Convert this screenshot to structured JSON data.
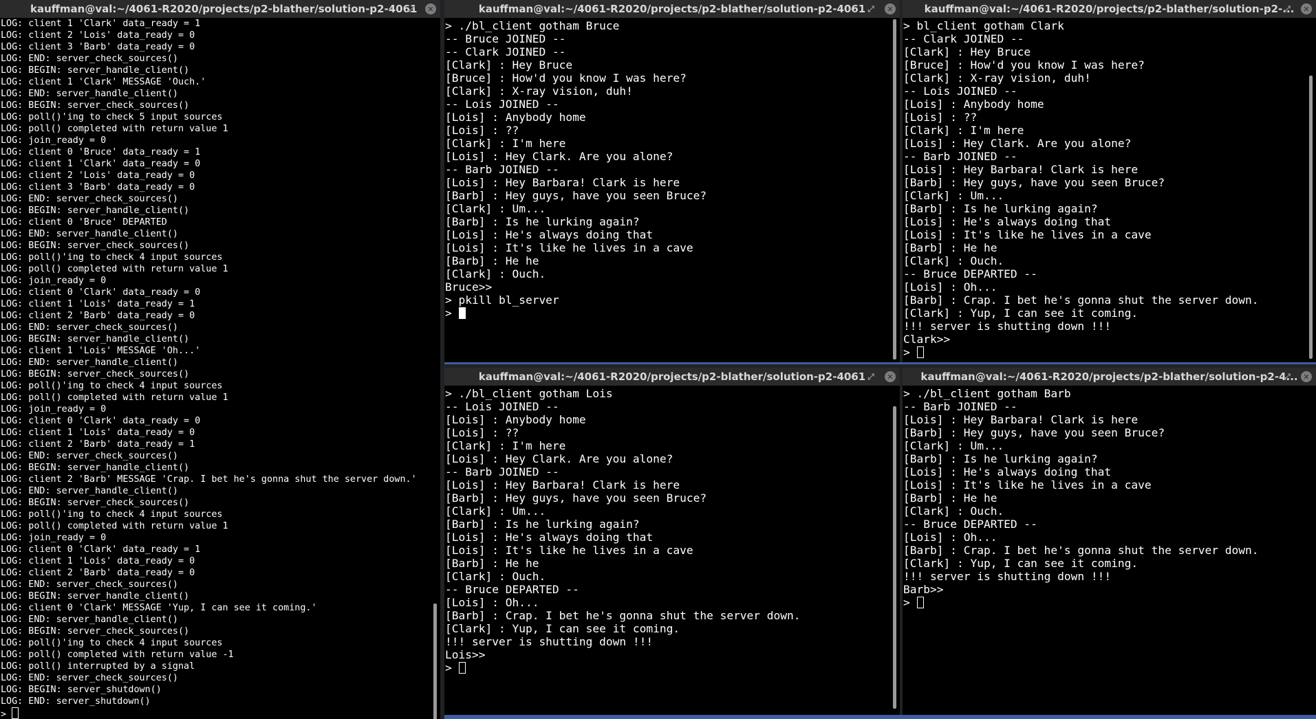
{
  "windows": {
    "server": {
      "title": "kauffman@val:~/4061-R2020/projects/p2-blather/solution-p2-4061",
      "lines": [
        "LOG: client 1 'Clark' data_ready = 1",
        "LOG: client 2 'Lois' data_ready = 0",
        "LOG: client 3 'Barb' data_ready = 0",
        "LOG: END: server_check_sources()",
        "LOG: BEGIN: server_handle_client()",
        "LOG: client 1 'Clark' MESSAGE 'Ouch.'",
        "LOG: END: server_handle_client()",
        "LOG: BEGIN: server_check_sources()",
        "LOG: poll()'ing to check 5 input sources",
        "LOG: poll() completed with return value 1",
        "LOG: join_ready = 0",
        "LOG: client 0 'Bruce' data_ready = 1",
        "LOG: client 1 'Clark' data_ready = 0",
        "LOG: client 2 'Lois' data_ready = 0",
        "LOG: client 3 'Barb' data_ready = 0",
        "LOG: END: server_check_sources()",
        "LOG: BEGIN: server_handle_client()",
        "LOG: client 0 'Bruce' DEPARTED",
        "LOG: END: server_handle_client()",
        "LOG: BEGIN: server_check_sources()",
        "LOG: poll()'ing to check 4 input sources",
        "LOG: poll() completed with return value 1",
        "LOG: join_ready = 0",
        "LOG: client 0 'Clark' data_ready = 0",
        "LOG: client 1 'Lois' data_ready = 1",
        "LOG: client 2 'Barb' data_ready = 0",
        "LOG: END: server_check_sources()",
        "LOG: BEGIN: server_handle_client()",
        "LOG: client 1 'Lois' MESSAGE 'Oh...'",
        "LOG: END: server_handle_client()",
        "LOG: BEGIN: server_check_sources()",
        "LOG: poll()'ing to check 4 input sources",
        "LOG: poll() completed with return value 1",
        "LOG: join_ready = 0",
        "LOG: client 0 'Clark' data_ready = 0",
        "LOG: client 1 'Lois' data_ready = 0",
        "LOG: client 2 'Barb' data_ready = 1",
        "LOG: END: server_check_sources()",
        "LOG: BEGIN: server_handle_client()",
        "LOG: client 2 'Barb' MESSAGE 'Crap. I bet he's gonna shut the server down.'",
        "LOG: END: server_handle_client()",
        "LOG: BEGIN: server_check_sources()",
        "LOG: poll()'ing to check 4 input sources",
        "LOG: poll() completed with return value 1",
        "LOG: join_ready = 0",
        "LOG: client 0 'Clark' data_ready = 1",
        "LOG: client 1 'Lois' data_ready = 0",
        "LOG: client 2 'Barb' data_ready = 0",
        "LOG: END: server_check_sources()",
        "LOG: BEGIN: server_handle_client()",
        "LOG: client 0 'Clark' MESSAGE 'Yup, I can see it coming.'",
        "LOG: END: server_handle_client()",
        "LOG: BEGIN: server_check_sources()",
        "LOG: poll()'ing to check 4 input sources",
        "LOG: poll() completed with return value -1",
        "LOG: poll() interrupted by a signal",
        "LOG: END: server_check_sources()",
        "LOG: BEGIN: server_shutdown()",
        "LOG: END: server_shutdown()"
      ],
      "prompt": "> "
    },
    "bruce": {
      "title": "kauffman@val:~/4061-R2020/projects/p2-blather/solution-p2-4061",
      "lines": [
        "> ./bl_client gotham Bruce",
        "-- Bruce JOINED --",
        "-- Clark JOINED --",
        "[Clark] : Hey Bruce",
        "[Bruce] : How'd you know I was here?",
        "[Clark] : X-ray vision, duh!",
        "-- Lois JOINED --",
        "[Lois] : Anybody home",
        "[Lois] : ??",
        "[Clark] : I'm here",
        "[Lois] : Hey Clark. Are you alone?",
        "-- Barb JOINED --",
        "[Lois] : Hey Barbara! Clark is here",
        "[Barb] : Hey guys, have you seen Bruce?",
        "[Clark] : Um...",
        "[Barb] : Is he lurking again?",
        "[Lois] : He's always doing that",
        "[Lois] : It's like he lives in a cave",
        "[Barb] : He he",
        "[Clark] : Ouch.",
        "Bruce>>",
        "> pkill bl_server"
      ],
      "prompt": "> "
    },
    "clark": {
      "title": "kauffman@val:~/4061-R2020/projects/p2-blather/solution-p2-...",
      "lines": [
        "> bl_client gotham Clark",
        "-- Clark JOINED --",
        "[Clark] : Hey Bruce",
        "[Bruce] : How'd you know I was here?",
        "[Clark] : X-ray vision, duh!",
        "-- Lois JOINED --",
        "[Lois] : Anybody home",
        "[Lois] : ??",
        "[Clark] : I'm here",
        "[Lois] : Hey Clark. Are you alone?",
        "-- Barb JOINED --",
        "[Lois] : Hey Barbara! Clark is here",
        "[Barb] : Hey guys, have you seen Bruce?",
        "[Clark] : Um...",
        "[Barb] : Is he lurking again?",
        "[Lois] : He's always doing that",
        "[Lois] : It's like he lives in a cave",
        "[Barb] : He he",
        "[Clark] : Ouch.",
        "-- Bruce DEPARTED --",
        "[Lois] : Oh...",
        "[Barb] : Crap. I bet he's gonna shut the server down.",
        "[Clark] : Yup, I can see it coming.",
        "!!! server is shutting down !!!",
        "Clark>>"
      ],
      "prompt": "> "
    },
    "lois": {
      "title": "kauffman@val:~/4061-R2020/projects/p2-blather/solution-p2-4061",
      "lines": [
        "> ./bl_client gotham Lois",
        "-- Lois JOINED --",
        "[Lois] : Anybody home",
        "[Lois] : ??",
        "[Clark] : I'm here",
        "[Lois] : Hey Clark. Are you alone?",
        "-- Barb JOINED --",
        "[Lois] : Hey Barbara! Clark is here",
        "[Barb] : Hey guys, have you seen Bruce?",
        "[Clark] : Um...",
        "[Barb] : Is he lurking again?",
        "[Lois] : He's always doing that",
        "[Lois] : It's like he lives in a cave",
        "[Barb] : He he",
        "[Clark] : Ouch.",
        "-- Bruce DEPARTED --",
        "[Lois] : Oh...",
        "[Barb] : Crap. I bet he's gonna shut the server down.",
        "[Clark] : Yup, I can see it coming.",
        "!!! server is shutting down !!!",
        "Lois>>"
      ],
      "prompt": "> "
    },
    "barb": {
      "title": "kauffman@val:~/4061-R2020/projects/p2-blather/solution-p2-4...",
      "lines": [
        "> ./bl_client gotham Barb",
        "-- Barb JOINED --",
        "[Lois] : Hey Barbara! Clark is here",
        "[Barb] : Hey guys, have you seen Bruce?",
        "[Clark] : Um...",
        "[Barb] : Is he lurking again?",
        "[Lois] : He's always doing that",
        "[Lois] : It's like he lives in a cave",
        "[Barb] : He he",
        "[Clark] : Ouch.",
        "-- Bruce DEPARTED --",
        "[Lois] : Oh...",
        "[Barb] : Crap. I bet he's gonna shut the server down.",
        "[Clark] : Yup, I can see it coming.",
        "!!! server is shutting down !!!",
        "Barb>>"
      ],
      "prompt": "> "
    }
  },
  "controls": {
    "minimize": "–",
    "maximize": "⤢",
    "close": "✕"
  },
  "colors": {
    "terminal_bg": "#000000",
    "terminal_fg": "#ffffff",
    "titlebar_bg": "#2b2b2b",
    "titlebar_fg": "#d8d8d8",
    "focus_accent": "#3d5f9e"
  }
}
